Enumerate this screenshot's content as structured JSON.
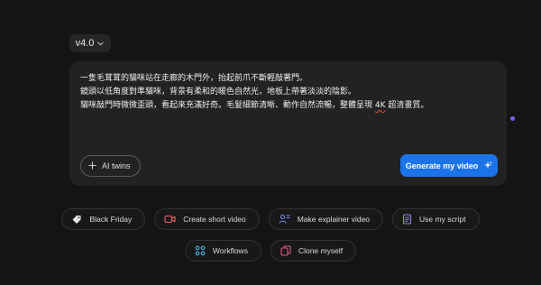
{
  "version": {
    "label": "v4.0",
    "icon": "chevron-down-icon"
  },
  "composer": {
    "prompt_lines": [
      "一隻毛茸茸的貓咪站在走廊的木門外，抬起前爪不斷輕敲著門。",
      "鏡頭以低角度對準貓咪，背景有柔和的暖色自然光，地板上帶著淡淡的陰影。",
      "貓咪敲門時微微歪頭，看起來充滿好奇。毛髮細節清晰、動作自然流暢，整體呈現 "
    ],
    "prompt_last_marked": "4K",
    "prompt_last_tail": " 超清畫質。",
    "ai_twins_label": "AI twins",
    "generate_label": "Generate my video"
  },
  "suggestions": {
    "row1": [
      {
        "label": "Black Friday",
        "icon": "tag-icon",
        "color": "#e6e6e6"
      },
      {
        "label": "Create short video",
        "icon": "video-camera-icon",
        "color": "#e0665c"
      },
      {
        "label": "Make explainer video",
        "icon": "presenter-icon",
        "color": "#7b8cf0"
      },
      {
        "label": "Use my script",
        "icon": "document-icon",
        "color": "#8f8cf5"
      }
    ],
    "row2": [
      {
        "label": "Workflows",
        "icon": "workflow-icon",
        "color": "#4fb8e6"
      },
      {
        "label": "Clone myself",
        "icon": "clone-icon",
        "color": "#e05a8a"
      }
    ]
  },
  "colors": {
    "background": "#141414",
    "panel": "#222222",
    "accent_blue": "#1a73e8",
    "cursor_purple": "#7a5cff"
  }
}
